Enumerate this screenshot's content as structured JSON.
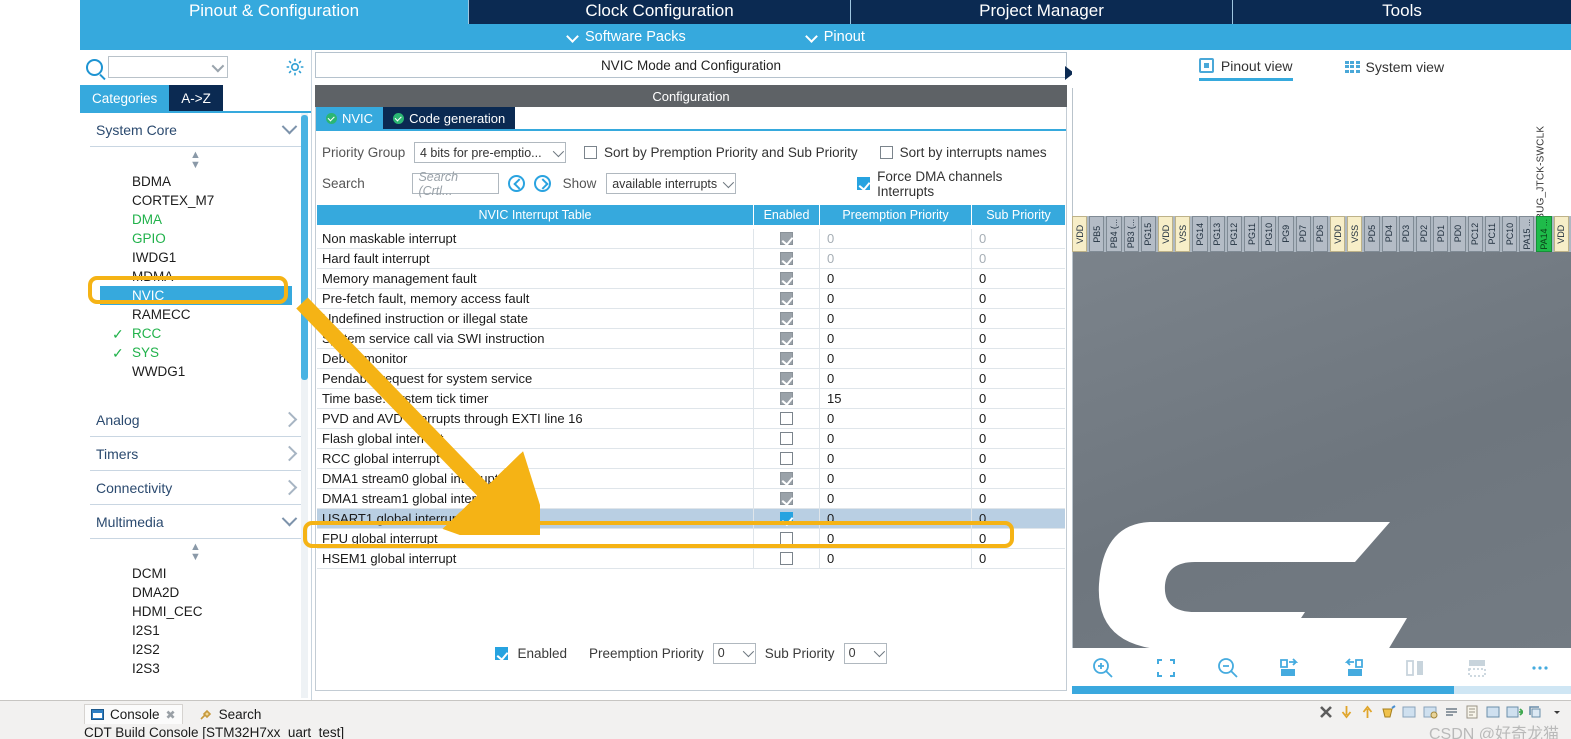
{
  "top_tabs": [
    {
      "label": "Pinout & Configuration",
      "active": true
    },
    {
      "label": "Clock Configuration",
      "active": false
    },
    {
      "label": "Project Manager",
      "active": false
    },
    {
      "label": "Tools",
      "active": false
    }
  ],
  "sub_menu": [
    {
      "label": "Software Packs",
      "icon": "chevron-down-icon"
    },
    {
      "label": "Pinout",
      "icon": "chevron-down-icon"
    }
  ],
  "sidebar": {
    "search_placeholder": "",
    "search_value": "",
    "icons": {
      "search": "search-icon",
      "settings": "gear-icon"
    },
    "mode_tabs": [
      {
        "label": "Categories",
        "selected": true
      },
      {
        "label": "A->Z",
        "selected": false
      }
    ],
    "groups": [
      {
        "name": "System Core",
        "expanded": true,
        "items": [
          {
            "label": "BDMA",
            "state": "normal"
          },
          {
            "label": "CORTEX_M7",
            "state": "normal"
          },
          {
            "label": "DMA",
            "state": "configured"
          },
          {
            "label": "GPIO",
            "state": "configured"
          },
          {
            "label": "IWDG1",
            "state": "normal"
          },
          {
            "label": "MDMA",
            "state": "normal"
          },
          {
            "label": "NVIC",
            "state": "selected"
          },
          {
            "label": "RAMECC",
            "state": "normal"
          },
          {
            "label": "RCC",
            "state": "checked"
          },
          {
            "label": "SYS",
            "state": "checked"
          },
          {
            "label": "WWDG1",
            "state": "normal"
          }
        ]
      },
      {
        "name": "Analog",
        "expanded": false,
        "items": []
      },
      {
        "name": "Timers",
        "expanded": false,
        "items": []
      },
      {
        "name": "Connectivity",
        "expanded": false,
        "items": []
      },
      {
        "name": "Multimedia",
        "expanded": true,
        "items": [
          {
            "label": "DCMI",
            "state": "normal"
          },
          {
            "label": "DMA2D",
            "state": "normal"
          },
          {
            "label": "HDMI_CEC",
            "state": "normal"
          },
          {
            "label": "I2S1",
            "state": "normal"
          },
          {
            "label": "I2S2",
            "state": "normal"
          },
          {
            "label": "I2S3",
            "state": "normal"
          }
        ]
      }
    ]
  },
  "config": {
    "title": "NVIC Mode and Configuration",
    "band": "Configuration",
    "sub_tabs": [
      {
        "label": "NVIC",
        "selected": true
      },
      {
        "label": "Code generation",
        "selected": false
      }
    ],
    "priority_group_label": "Priority Group",
    "priority_group_value": "4 bits for pre-emptio...",
    "sort_premption_label": "Sort by Premption Priority and Sub Priority",
    "sort_premption_checked": false,
    "sort_names_label": "Sort by interrupts names",
    "sort_names_checked": false,
    "search_label": "Search",
    "search_placeholder": "Search (Crtl...",
    "search_value": "",
    "show_label": "Show",
    "show_value": "available interrupts",
    "force_dma_label": "Force DMA channels Interrupts",
    "force_dma_checked": true,
    "table": {
      "headers": [
        "NVIC Interrupt Table",
        "Enabled",
        "Preemption Priority",
        "Sub Priority"
      ],
      "rows": [
        {
          "name": "Non maskable interrupt",
          "enabled": true,
          "locked": true,
          "pre": "0",
          "sub": "0",
          "dim": true,
          "highlight": false
        },
        {
          "name": "Hard fault interrupt",
          "enabled": true,
          "locked": true,
          "pre": "0",
          "sub": "0",
          "dim": true,
          "highlight": false
        },
        {
          "name": "Memory management fault",
          "enabled": true,
          "locked": true,
          "pre": "0",
          "sub": "0",
          "dim": false,
          "highlight": false
        },
        {
          "name": "Pre-fetch fault, memory access fault",
          "enabled": true,
          "locked": true,
          "pre": "0",
          "sub": "0",
          "dim": false,
          "highlight": false
        },
        {
          "name": "Undefined instruction or illegal state",
          "enabled": true,
          "locked": true,
          "pre": "0",
          "sub": "0",
          "dim": false,
          "highlight": false
        },
        {
          "name": "System service call via SWI instruction",
          "enabled": true,
          "locked": true,
          "pre": "0",
          "sub": "0",
          "dim": false,
          "highlight": false
        },
        {
          "name": "Debug monitor",
          "enabled": true,
          "locked": true,
          "pre": "0",
          "sub": "0",
          "dim": false,
          "highlight": false
        },
        {
          "name": "Pendable request for system service",
          "enabled": true,
          "locked": true,
          "pre": "0",
          "sub": "0",
          "dim": false,
          "highlight": false
        },
        {
          "name": "Time base: System tick timer",
          "enabled": true,
          "locked": true,
          "pre": "15",
          "sub": "0",
          "dim": false,
          "highlight": false
        },
        {
          "name": "PVD and AVD interrupts through EXTI line 16",
          "enabled": false,
          "locked": false,
          "pre": "0",
          "sub": "0",
          "dim": false,
          "highlight": false
        },
        {
          "name": "Flash global interrupt",
          "enabled": false,
          "locked": false,
          "pre": "0",
          "sub": "0",
          "dim": false,
          "highlight": false
        },
        {
          "name": "RCC global interrupt",
          "enabled": false,
          "locked": false,
          "pre": "0",
          "sub": "0",
          "dim": false,
          "highlight": false
        },
        {
          "name": "DMA1 stream0 global interrupt",
          "enabled": true,
          "locked": true,
          "pre": "0",
          "sub": "0",
          "dim": false,
          "highlight": false
        },
        {
          "name": "DMA1 stream1 global interrupt",
          "enabled": true,
          "locked": true,
          "pre": "0",
          "sub": "0",
          "dim": false,
          "highlight": false
        },
        {
          "name": "USART1 global interrupt",
          "enabled": true,
          "locked": false,
          "pre": "0",
          "sub": "0",
          "dim": false,
          "highlight": true
        },
        {
          "name": "FPU global interrupt",
          "enabled": false,
          "locked": false,
          "pre": "0",
          "sub": "0",
          "dim": false,
          "highlight": false
        },
        {
          "name": "HSEM1 global interrupt",
          "enabled": false,
          "locked": false,
          "pre": "0",
          "sub": "0",
          "dim": false,
          "highlight": false
        }
      ]
    },
    "bottom": {
      "enabled_label": "Enabled",
      "enabled_checked": true,
      "preemption_label": "Preemption Priority",
      "preemption_value": "0",
      "sub_label": "Sub Priority",
      "sub_value": "0"
    }
  },
  "pinout": {
    "view_tabs": [
      {
        "label": "Pinout view",
        "icon": "chip-icon",
        "selected": true
      },
      {
        "label": "System view",
        "icon": "grid-icon",
        "selected": false
      }
    ],
    "signal_label": "DEBUG_JTCK-SWCLK",
    "pins": [
      {
        "name": "VDD",
        "type": "power"
      },
      {
        "name": "PB5",
        "type": "normal"
      },
      {
        "name": "PB4 (...",
        "type": "normal"
      },
      {
        "name": "PB3 (...",
        "type": "normal"
      },
      {
        "name": "PG15",
        "type": "normal"
      },
      {
        "name": "VDD",
        "type": "power"
      },
      {
        "name": "VSS",
        "type": "power"
      },
      {
        "name": "PG14",
        "type": "normal"
      },
      {
        "name": "PG13",
        "type": "normal"
      },
      {
        "name": "PG12",
        "type": "normal"
      },
      {
        "name": "PG11",
        "type": "normal"
      },
      {
        "name": "PG10",
        "type": "normal"
      },
      {
        "name": "PG9",
        "type": "normal"
      },
      {
        "name": "PD7",
        "type": "normal"
      },
      {
        "name": "PD6",
        "type": "normal"
      },
      {
        "name": "VDD",
        "type": "power"
      },
      {
        "name": "VSS",
        "type": "power"
      },
      {
        "name": "PD5",
        "type": "normal"
      },
      {
        "name": "PD4",
        "type": "normal"
      },
      {
        "name": "PD3",
        "type": "normal"
      },
      {
        "name": "PD2",
        "type": "normal"
      },
      {
        "name": "PD1",
        "type": "normal"
      },
      {
        "name": "PD0",
        "type": "normal"
      },
      {
        "name": "PC12",
        "type": "normal"
      },
      {
        "name": "PC11",
        "type": "normal"
      },
      {
        "name": "PC10",
        "type": "normal"
      },
      {
        "name": "PA15 ...",
        "type": "normal"
      },
      {
        "name": "PA14 ...",
        "type": "active"
      },
      {
        "name": "VDD",
        "type": "power"
      }
    ],
    "tools": [
      {
        "icon": "zoom-in-icon",
        "name": "zoom-in"
      },
      {
        "icon": "fit-icon",
        "name": "fit-to-screen"
      },
      {
        "icon": "zoom-out-icon",
        "name": "zoom-out"
      },
      {
        "icon": "rotate-right-icon",
        "name": "rotate-clockwise"
      },
      {
        "icon": "rotate-left-icon",
        "name": "rotate-counterclockwise"
      },
      {
        "icon": "flip-horizontal-icon",
        "name": "flip-horizontal"
      },
      {
        "icon": "flip-vertical-icon",
        "name": "flip-vertical"
      },
      {
        "icon": "more-icon",
        "name": "more-options"
      }
    ]
  },
  "console": {
    "tabs": [
      {
        "label": "Console",
        "active": true,
        "icon": "console-icon",
        "closable": true
      },
      {
        "label": "Search",
        "active": false,
        "icon": "search-pin-icon",
        "closable": false
      }
    ],
    "line": "CDT Build Console [STM32H7xx_uart_test]",
    "watermark": "CSDN @好奇龙猫"
  },
  "colors": {
    "accent_blue": "#36a9dd",
    "dark_navy": "#0b2a52",
    "annotation_yellow": "#f5b315",
    "configured_green": "#21b24b",
    "highlight_row": "#b9cfe3"
  }
}
